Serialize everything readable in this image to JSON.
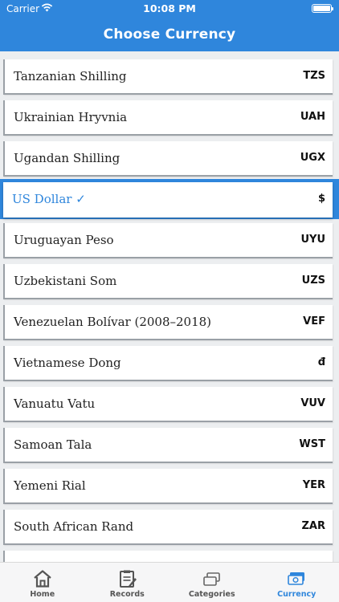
{
  "status_bar": {
    "carrier": "Carrier",
    "time": "10:08 PM"
  },
  "header": {
    "title": "Choose Currency"
  },
  "currencies": [
    {
      "name": "Tanzanian Shilling",
      "code": "TZS"
    },
    {
      "name": "Ukrainian Hryvnia",
      "code": "UAH"
    },
    {
      "name": "Ugandan Shilling",
      "code": "UGX"
    },
    {
      "name": "US Dollar ✓",
      "code": "$",
      "selected": true
    },
    {
      "name": "Uruguayan Peso",
      "code": "UYU"
    },
    {
      "name": "Uzbekistani Som",
      "code": "UZS"
    },
    {
      "name": "Venezuelan Bolívar (2008–2018)",
      "code": "VEF"
    },
    {
      "name": "Vietnamese Dong",
      "code": "đ"
    },
    {
      "name": "Vanuatu Vatu",
      "code": "VUV"
    },
    {
      "name": "Samoan Tala",
      "code": "WST"
    },
    {
      "name": "Yemeni Rial",
      "code": "YER"
    },
    {
      "name": "South African Rand",
      "code": "ZAR"
    }
  ],
  "tabbar": {
    "tabs": [
      {
        "label": "Home",
        "icon": "home-icon"
      },
      {
        "label": "Records",
        "icon": "records-icon"
      },
      {
        "label": "Categories",
        "icon": "categories-icon"
      },
      {
        "label": "Currency",
        "icon": "currency-icon",
        "active": true
      }
    ]
  },
  "colors": {
    "accent": "#2f86dc",
    "background": "#eceef0"
  }
}
